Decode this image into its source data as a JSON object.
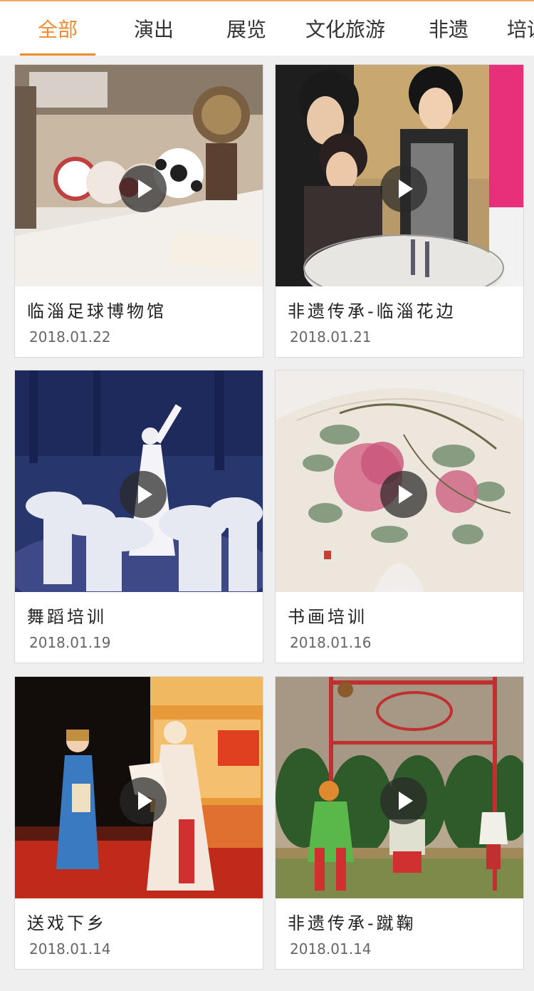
{
  "tabs": [
    {
      "label": "全部",
      "active": true
    },
    {
      "label": "演出",
      "active": false
    },
    {
      "label": "展览",
      "active": false
    },
    {
      "label": "文化旅游",
      "active": false
    },
    {
      "label": "非遗",
      "active": false
    },
    {
      "label": "培训",
      "active": false
    }
  ],
  "accent_color": "#f08a2e",
  "play_icon": "play-icon",
  "cards": [
    {
      "title": "临淄足球博物馆",
      "date": "2018.01.22"
    },
    {
      "title": "非遗传承-临淄花边",
      "date": "2018.01.21"
    },
    {
      "title": "舞蹈培训",
      "date": "2018.01.19"
    },
    {
      "title": "书画培训",
      "date": "2018.01.16"
    },
    {
      "title": "送戏下乡",
      "date": "2018.01.14"
    },
    {
      "title": "非遗传承-蹴鞠",
      "date": "2018.01.14"
    }
  ]
}
